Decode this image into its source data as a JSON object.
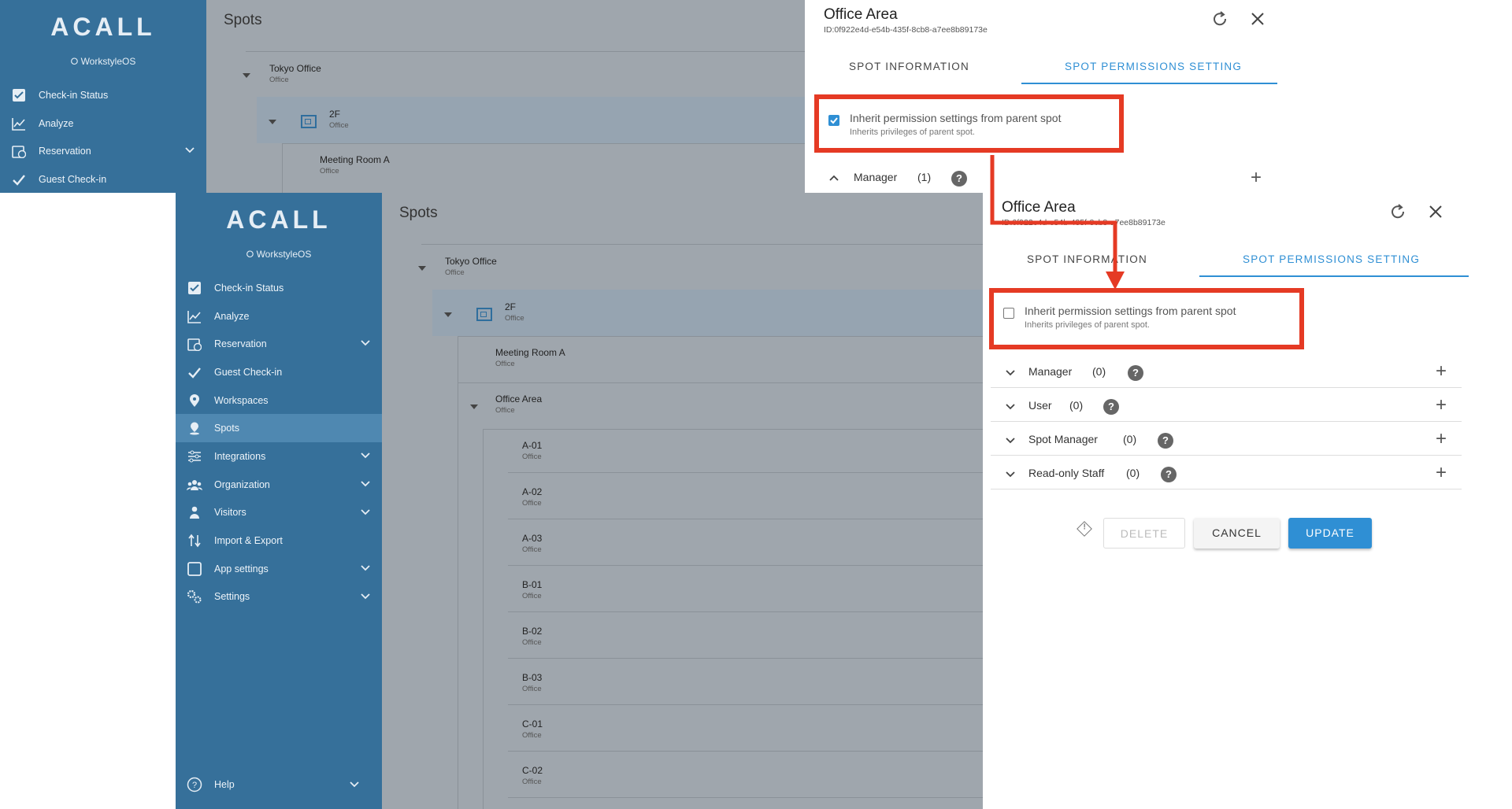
{
  "app": {
    "logo": "ACALL",
    "sublogo": "WorkstyleOS",
    "page_title": "Spots",
    "help_label": "Help"
  },
  "sidebar": {
    "items": [
      {
        "label": "Check-in Status",
        "icon": "checkbox-icon"
      },
      {
        "label": "Analyze",
        "icon": "chart-icon"
      },
      {
        "label": "Reservation",
        "icon": "calendar-icon"
      },
      {
        "label": "Guest Check-in",
        "icon": "check-icon"
      },
      {
        "label": "Workspaces",
        "icon": "pin-icon"
      },
      {
        "label": "Spots",
        "icon": "spot-icon"
      },
      {
        "label": "Integrations",
        "icon": "sliders-icon"
      },
      {
        "label": "Organization",
        "icon": "people-icon"
      },
      {
        "label": "Visitors",
        "icon": "visitor-icon"
      },
      {
        "label": "Import & Export",
        "icon": "transfer-icon"
      },
      {
        "label": "App settings",
        "icon": "tablet-icon"
      },
      {
        "label": "Settings",
        "icon": "gear-icon"
      }
    ]
  },
  "tree": {
    "root": {
      "name": "Tokyo Office",
      "type": "Office"
    },
    "floor": {
      "name": "2F",
      "type": "Office"
    },
    "rooms": [
      {
        "name": "Meeting Room A",
        "type": "Office"
      },
      {
        "name": "Office Area",
        "type": "Office"
      }
    ],
    "desks": [
      {
        "name": "A-01",
        "type": "Office"
      },
      {
        "name": "A-02",
        "type": "Office"
      },
      {
        "name": "A-03",
        "type": "Office"
      },
      {
        "name": "B-01",
        "type": "Office"
      },
      {
        "name": "B-02",
        "type": "Office"
      },
      {
        "name": "B-03",
        "type": "Office"
      },
      {
        "name": "C-01",
        "type": "Office"
      },
      {
        "name": "C-02",
        "type": "Office"
      }
    ]
  },
  "panel": {
    "title": "Office Area",
    "id_text": "ID:0f922e4d-e54b-435f-8cb8-a7ee8b89173e",
    "tabs": [
      "SPOT INFORMATION",
      "SPOT PERMISSIONS SETTING"
    ],
    "inherit_label": "Inherit permission settings from parent spot",
    "inherit_sub": "Inherits privileges of parent spot.",
    "before": {
      "inherit_checked": true,
      "manager_label": "Manager",
      "manager_count": "(1)"
    },
    "after": {
      "inherit_checked": false,
      "permissions": [
        {
          "name": "Manager",
          "count": "(0)"
        },
        {
          "name": "User",
          "count": "(0)"
        },
        {
          "name": "Spot Manager",
          "count": "(0)"
        },
        {
          "name": "Read-only Staff",
          "count": "(0)"
        }
      ]
    },
    "buttons": {
      "delete": "DELETE",
      "cancel": "CANCEL",
      "update": "UPDATE"
    }
  },
  "colors": {
    "sidebar": "#36709a",
    "sidebar_active": "#4f88b1",
    "content_overlay": "#9fa6ad",
    "accent": "#2f8fd4",
    "highlight": "#e53a24"
  }
}
